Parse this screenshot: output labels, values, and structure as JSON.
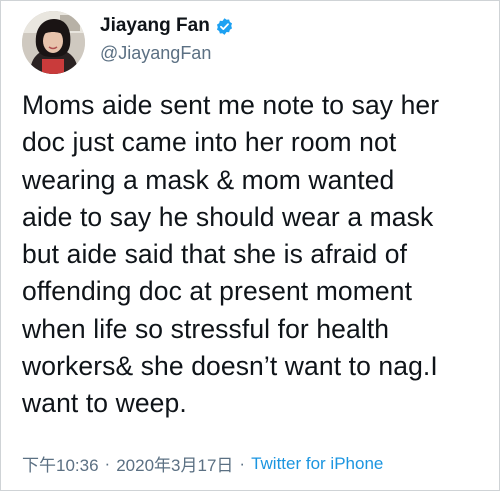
{
  "author": {
    "display_name": "Jiayang Fan",
    "handle": "@JiayangFan",
    "verified": true,
    "badge_color": "#1da1f2"
  },
  "tweet": {
    "lines": [
      "Moms aide sent me note to say her",
      "doc just came into her room not",
      "wearing a mask & mom wanted",
      "aide to say he should wear a mask",
      "but aide said that she is afraid of",
      "offending doc at present moment",
      "when life so stressful for health",
      "workers& she doesn’t want to nag.I",
      "want to weep."
    ]
  },
  "meta": {
    "time": "下午10:36",
    "separator": "·",
    "date": "2020年3月17日",
    "source": "Twitter for iPhone",
    "source_color": "#1b95e0"
  }
}
